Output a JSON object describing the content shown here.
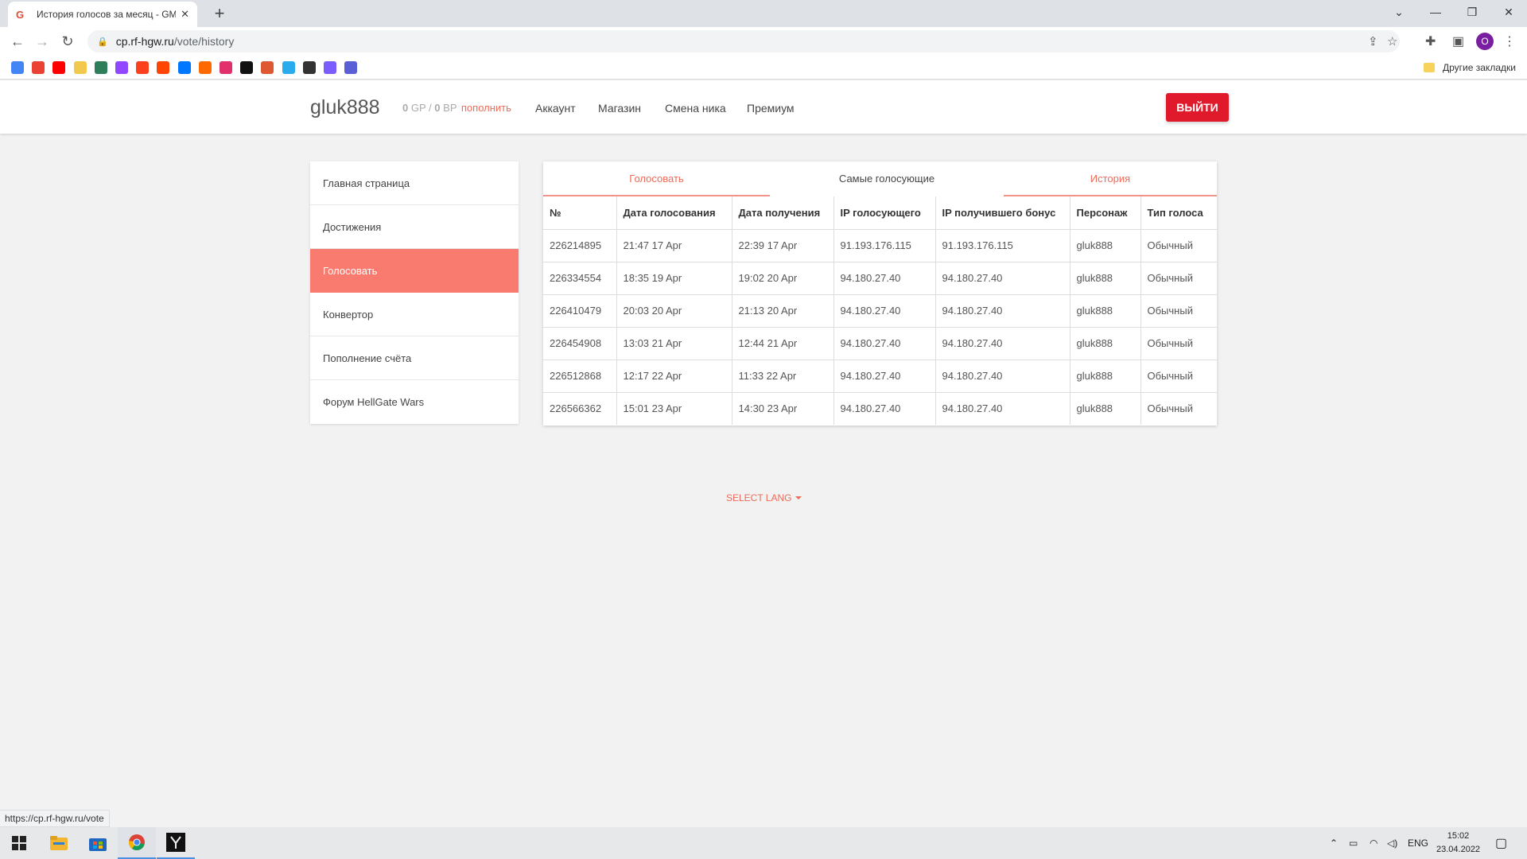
{
  "browser": {
    "tab_title": "История голосов за месяц - GM",
    "tab_favicon": "G",
    "url_host": "cp.rf-hgw.ru",
    "url_path": "/vote/history",
    "profile_initial": "O",
    "other_bookmarks": "Другие закладки",
    "bookmark_colors": [
      "#4285f4",
      "#ea4335",
      "#ff0000",
      "#f2c94c",
      "#2e7d5b",
      "#9146ff",
      "#fc3f1d",
      "#ff4500",
      "#0077ff",
      "#ff6a00",
      "#e1306c",
      "#111111",
      "#de5833",
      "#2aabee",
      "#333333",
      "#7b5cff",
      "#5a5fd6"
    ]
  },
  "site": {
    "username": "gluk888",
    "gp_value": "0",
    "gp_unit": "GP",
    "separator": "/",
    "bp_value": "0",
    "bp_unit": "BP",
    "topup": "пополнить",
    "nav": [
      "Аккаунт",
      "Магазин",
      "Смена ника",
      "Премиум"
    ],
    "logout": "ВЫЙТИ",
    "accent": "#ef6b5a",
    "logout_color": "#e0192b"
  },
  "sidebar": {
    "items": [
      "Главная страница",
      "Достижения",
      "Голосовать",
      "Конвертор",
      "Пополнение счёта",
      "Форум HellGate Wars"
    ],
    "active_index": 2
  },
  "vote_tabs": [
    "Голосовать",
    "Самые голосующие",
    "История"
  ],
  "history": {
    "columns": [
      "№",
      "Дата голосования",
      "Дата получения",
      "IP голосующего",
      "IP получившего бонус",
      "Персонаж",
      "Тип голоса"
    ],
    "rows": [
      [
        "226214895",
        "21:47 17 Apr",
        "22:39 17 Apr",
        "91.193.176.115",
        "91.193.176.115",
        "gluk888",
        "Обычный"
      ],
      [
        "226334554",
        "18:35 19 Apr",
        "19:02 20 Apr",
        "94.180.27.40",
        "94.180.27.40",
        "gluk888",
        "Обычный"
      ],
      [
        "226410479",
        "20:03 20 Apr",
        "21:13 20 Apr",
        "94.180.27.40",
        "94.180.27.40",
        "gluk888",
        "Обычный"
      ],
      [
        "226454908",
        "13:03 21 Apr",
        "12:44 21 Apr",
        "94.180.27.40",
        "94.180.27.40",
        "gluk888",
        "Обычный"
      ],
      [
        "226512868",
        "12:17 22 Apr",
        "11:33 22 Apr",
        "94.180.27.40",
        "94.180.27.40",
        "gluk888",
        "Обычный"
      ],
      [
        "226566362",
        "15:01 23 Apr",
        "14:30 23 Apr",
        "94.180.27.40",
        "94.180.27.40",
        "gluk888",
        "Обычный"
      ]
    ]
  },
  "select_lang": "SELECT LANG",
  "status_url": "https://cp.rf-hgw.ru/vote",
  "taskbar": {
    "lang": "ENG",
    "time": "15:02",
    "date": "23.04.2022"
  }
}
